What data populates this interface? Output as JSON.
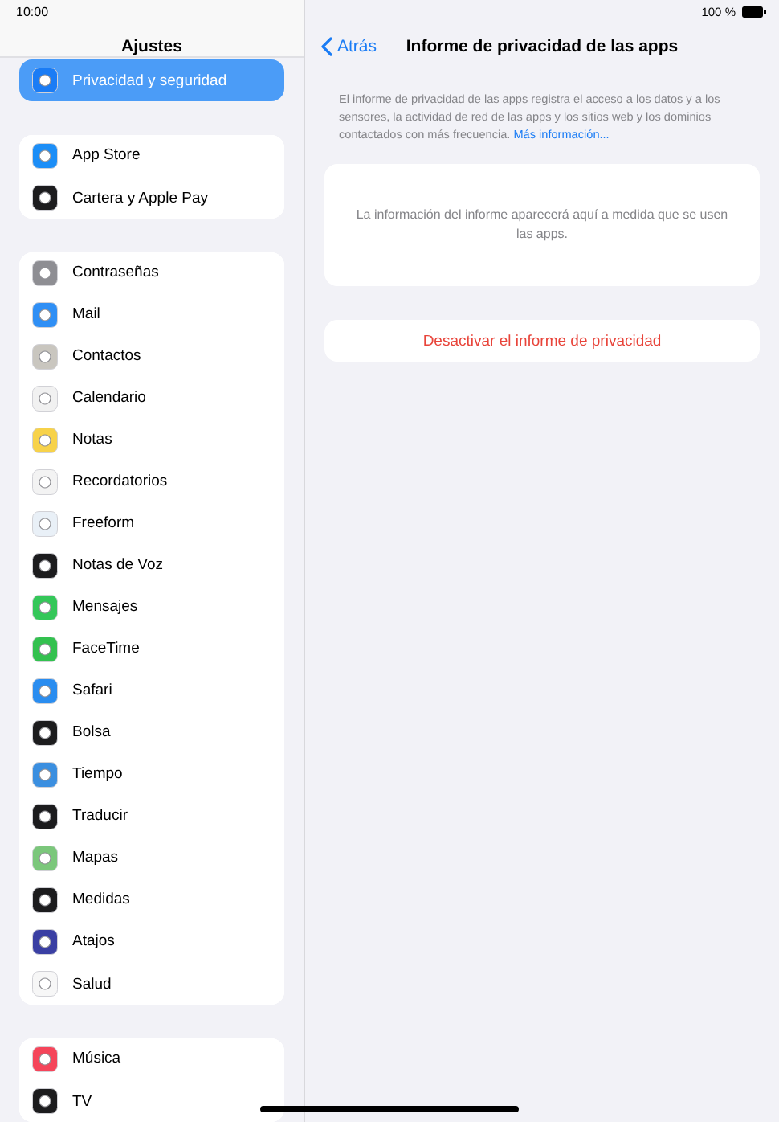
{
  "status_bar": {
    "time": "10:00",
    "battery": "100 %"
  },
  "sidebar": {
    "title": "Ajustes",
    "groups": [
      {
        "items": [
          {
            "label": "Privacidad y seguridad",
            "selected": true,
            "color": "#1a7cf5"
          }
        ]
      },
      {
        "items": [
          {
            "label": "App Store",
            "selected": false,
            "color": "#1c8ef7"
          },
          {
            "label": "Cartera y Apple Pay",
            "selected": false,
            "color": "#1c1c1e"
          }
        ]
      },
      {
        "items": [
          {
            "label": "Contraseñas",
            "selected": false,
            "color": "#8e8e93"
          },
          {
            "label": "Mail",
            "selected": false,
            "color": "#2f8ff5"
          },
          {
            "label": "Contactos",
            "selected": false,
            "color": "#c9c6bf"
          },
          {
            "label": "Calendario",
            "selected": false,
            "color": "#f1f1f1"
          },
          {
            "label": "Notas",
            "selected": false,
            "color": "#f7d24a"
          },
          {
            "label": "Recordatorios",
            "selected": false,
            "color": "#f3f3f3"
          },
          {
            "label": "Freeform",
            "selected": false,
            "color": "#e9f0f7"
          },
          {
            "label": "Notas de Voz",
            "selected": false,
            "color": "#1c1c1e"
          },
          {
            "label": "Mensajes",
            "selected": false,
            "color": "#34c759"
          },
          {
            "label": "FaceTime",
            "selected": false,
            "color": "#33c14f"
          },
          {
            "label": "Safari",
            "selected": false,
            "color": "#2a8df0"
          },
          {
            "label": "Bolsa",
            "selected": false,
            "color": "#1c1c1e"
          },
          {
            "label": "Tiempo",
            "selected": false,
            "color": "#3b8fe0"
          },
          {
            "label": "Traducir",
            "selected": false,
            "color": "#1c1c1e"
          },
          {
            "label": "Mapas",
            "selected": false,
            "color": "#7bc77b"
          },
          {
            "label": "Medidas",
            "selected": false,
            "color": "#1c1c1e"
          },
          {
            "label": "Atajos",
            "selected": false,
            "color": "#3a3fa3"
          },
          {
            "label": "Salud",
            "selected": false,
            "color": "#f7f7f7"
          }
        ]
      },
      {
        "items": [
          {
            "label": "Música",
            "selected": false,
            "color": "#f5455a"
          },
          {
            "label": "TV",
            "selected": false,
            "color": "#1c1c1e"
          }
        ]
      }
    ]
  },
  "detail": {
    "back": "Atrás",
    "title": "Informe de privacidad de las apps",
    "description": "El informe de privacidad de las apps registra el acceso a los datos y a los sensores, la actividad de red de las apps y los sitios web y los dominios contactados con más frecuencia.",
    "more_link": "Más información...",
    "empty_message": "La información del informe aparecerá aquí a medida que se usen las apps.",
    "disable_button": "Desactivar el informe de privacidad"
  }
}
